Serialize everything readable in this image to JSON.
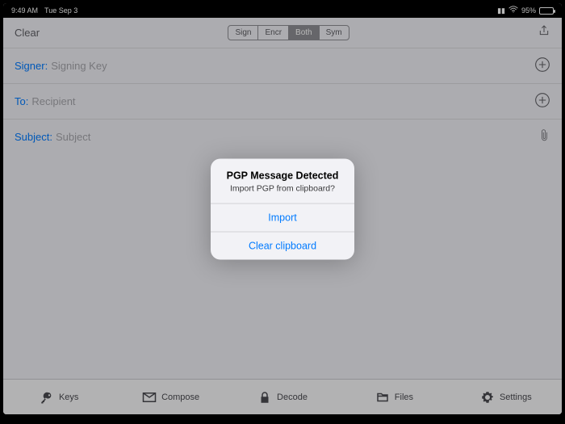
{
  "statusbar": {
    "time": "9:49 AM",
    "date": "Tue Sep 3",
    "battery_pct": "95%"
  },
  "topbar": {
    "clear_label": "Clear",
    "seg": {
      "sign": "Sign",
      "encr": "Encr",
      "both": "Both",
      "sym": "Sym"
    }
  },
  "fields": {
    "signer_label": "Signer:",
    "signer_placeholder": "Signing Key",
    "to_label": "To:",
    "to_placeholder": "Recipient",
    "subject_label": "Subject:",
    "subject_placeholder": "Subject"
  },
  "alert": {
    "title": "PGP Message Detected",
    "message": "Import PGP from clipboard?",
    "import_label": "Import",
    "clear_label": "Clear clipboard"
  },
  "tabs": {
    "keys": "Keys",
    "compose": "Compose",
    "decode": "Decode",
    "files": "Files",
    "settings": "Settings"
  }
}
